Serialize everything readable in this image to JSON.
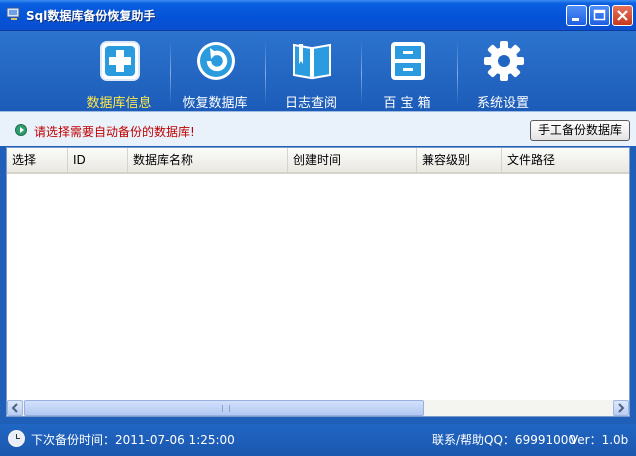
{
  "window": {
    "title": "Sql数据库备份恢复助手"
  },
  "toolbar": {
    "items": [
      {
        "label": "数据库信息",
        "icon": "plus-square-icon",
        "active": true
      },
      {
        "label": "恢复数据库",
        "icon": "restore-circle-arrow-icon",
        "active": false
      },
      {
        "label": "日志查阅",
        "icon": "open-book-icon",
        "active": false
      },
      {
        "label": "百 宝 箱",
        "icon": "drawer-cabinet-icon",
        "active": false
      },
      {
        "label": "系统设置",
        "icon": "gear-icon",
        "active": false
      }
    ]
  },
  "hint": {
    "text": "请选择需要自动备份的数据库!",
    "manual_backup_label": "手工备份数据库"
  },
  "grid": {
    "columns": [
      "选择",
      "ID",
      "数据库名称",
      "创建时间",
      "兼容级别",
      "文件路径"
    ],
    "rows": [],
    "scroll_grip": "⁞⁞⁞"
  },
  "status": {
    "next_backup": "下次备份时间：2011-07-06 1:25:00",
    "contact": "联系/帮助QQ：69991000",
    "version": "Ver：1.0b"
  },
  "colors": {
    "accent": "#1f5fb8",
    "active_label": "#ffe84a",
    "hint_text": "#c00000"
  }
}
